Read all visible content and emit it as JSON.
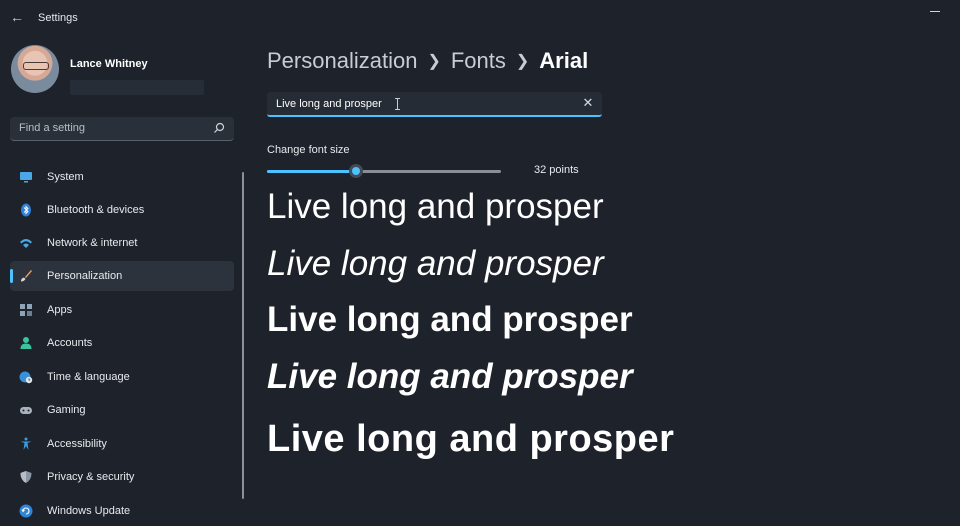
{
  "window": {
    "title": "Settings"
  },
  "user": {
    "name": "Lance Whitney"
  },
  "search": {
    "placeholder": "Find a setting"
  },
  "sidebar": {
    "items": [
      {
        "label": "System",
        "icon": "monitor-icon",
        "selected": false
      },
      {
        "label": "Bluetooth & devices",
        "icon": "bluetooth-icon",
        "selected": false
      },
      {
        "label": "Network & internet",
        "icon": "wifi-icon",
        "selected": false
      },
      {
        "label": "Personalization",
        "icon": "brush-icon",
        "selected": true
      },
      {
        "label": "Apps",
        "icon": "apps-icon",
        "selected": false
      },
      {
        "label": "Accounts",
        "icon": "person-icon",
        "selected": false
      },
      {
        "label": "Time & language",
        "icon": "globe-clock-icon",
        "selected": false
      },
      {
        "label": "Gaming",
        "icon": "gamepad-icon",
        "selected": false
      },
      {
        "label": "Accessibility",
        "icon": "accessibility-icon",
        "selected": false
      },
      {
        "label": "Privacy & security",
        "icon": "shield-icon",
        "selected": false
      },
      {
        "label": "Windows Update",
        "icon": "update-icon",
        "selected": false
      }
    ]
  },
  "breadcrumb": {
    "level1": "Personalization",
    "level2": "Fonts",
    "current": "Arial"
  },
  "preview": {
    "text": "Live long and prosper"
  },
  "font_size": {
    "label": "Change font size",
    "value_text": "32 points",
    "fraction": 0.38
  },
  "samples": [
    {
      "text": "Live long and prosper",
      "style": "Regular"
    },
    {
      "text": "Live long and prosper",
      "style": "Italic"
    },
    {
      "text": "Live long and prosper",
      "style": "Bold"
    },
    {
      "text": "Live long and prosper",
      "style": "Bold Italic"
    },
    {
      "text": "Live long and prosper",
      "style": "Black"
    }
  ],
  "colors": {
    "accent": "#4cc2ff",
    "background": "#1d222b",
    "selected_item": "#2d333c"
  }
}
